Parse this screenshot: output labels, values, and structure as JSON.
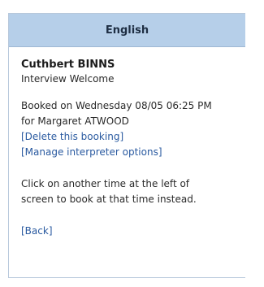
{
  "panel": {
    "title": "English",
    "person_name": "Cuthbert BINNS",
    "appointment_type": "Interview Welcome",
    "booked_line": "Booked on Wednesday 08/05 06:25 PM",
    "booked_for": "for Margaret ATWOOD",
    "delete_link": "[Delete this booking]",
    "manage_link": "[Manage interpreter options]",
    "instruction_line1": "Click on another time at the left of",
    "instruction_line2": "screen to book at that time instead.",
    "back_link": "[Back]"
  },
  "colors": {
    "header_bg": "#b6cfe9",
    "link": "#2a5aa0",
    "border": "#b7c8dc"
  }
}
